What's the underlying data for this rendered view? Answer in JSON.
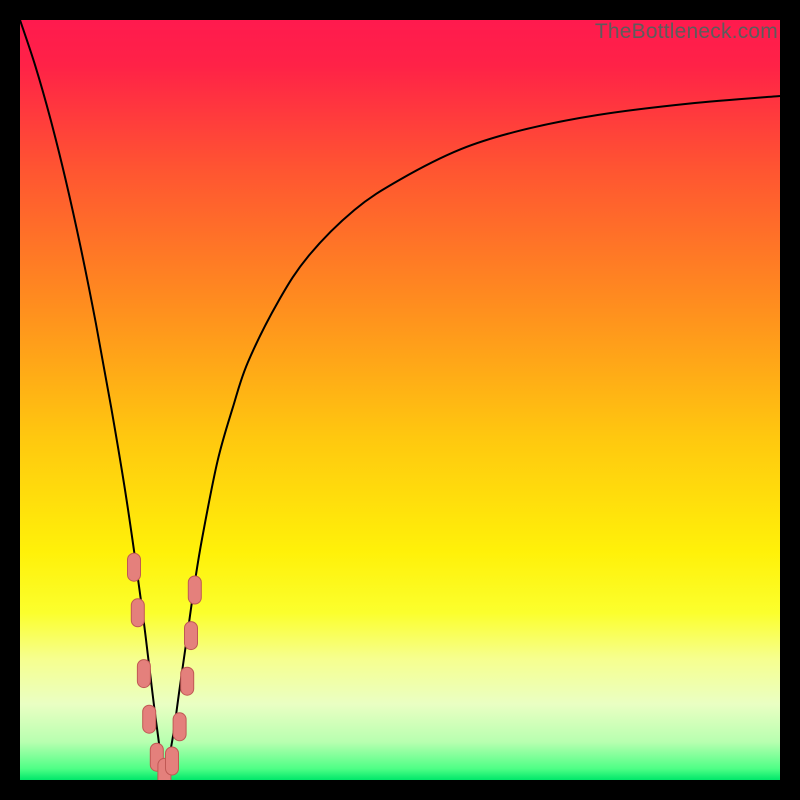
{
  "watermark": "TheBottleneck.com",
  "colors": {
    "frame": "#000000",
    "curve": "#000000",
    "marker_fill": "#e4807c",
    "marker_stroke": "#c05854",
    "gradient_stops": [
      {
        "offset": 0.0,
        "color": "#ff1a4e"
      },
      {
        "offset": 0.06,
        "color": "#ff2247"
      },
      {
        "offset": 0.2,
        "color": "#ff5631"
      },
      {
        "offset": 0.38,
        "color": "#ff8f1e"
      },
      {
        "offset": 0.55,
        "color": "#ffc80f"
      },
      {
        "offset": 0.7,
        "color": "#fff109"
      },
      {
        "offset": 0.78,
        "color": "#fbff2d"
      },
      {
        "offset": 0.84,
        "color": "#f6ff8e"
      },
      {
        "offset": 0.9,
        "color": "#eaffc3"
      },
      {
        "offset": 0.95,
        "color": "#b8ffb0"
      },
      {
        "offset": 0.985,
        "color": "#4fff86"
      },
      {
        "offset": 1.0,
        "color": "#00e76a"
      }
    ]
  },
  "chart_data": {
    "type": "line",
    "title": "",
    "xlabel": "",
    "ylabel": "",
    "xlim": [
      0,
      100
    ],
    "ylim": [
      0,
      100
    ],
    "grid": false,
    "note": "V-shaped bottleneck curve; x is normalized component scale (0–100), y is estimated bottleneck % (0=none, 100=severe). Minimum near x≈19.",
    "series": [
      {
        "name": "bottleneck_percent",
        "x": [
          0,
          2,
          4,
          6,
          8,
          10,
          12,
          14,
          16,
          17,
          18,
          19,
          20,
          21,
          22,
          23,
          24,
          26,
          28,
          30,
          34,
          38,
          44,
          50,
          58,
          66,
          76,
          88,
          100
        ],
        "values": [
          100,
          94,
          87,
          79,
          70,
          60,
          49,
          37,
          23,
          15,
          7,
          1,
          5,
          12,
          19,
          26,
          32,
          42,
          49,
          55,
          63,
          69,
          75,
          79,
          83,
          85.5,
          87.5,
          89,
          90
        ]
      }
    ],
    "markers": {
      "name": "highlighted_points",
      "note": "Pill-shaped markers clustered around the curve's trough.",
      "points": [
        {
          "x": 15.0,
          "y": 28
        },
        {
          "x": 15.5,
          "y": 22
        },
        {
          "x": 16.3,
          "y": 14
        },
        {
          "x": 17.0,
          "y": 8
        },
        {
          "x": 18.0,
          "y": 3
        },
        {
          "x": 19.0,
          "y": 1
        },
        {
          "x": 20.0,
          "y": 2.5
        },
        {
          "x": 21.0,
          "y": 7
        },
        {
          "x": 22.0,
          "y": 13
        },
        {
          "x": 22.5,
          "y": 19
        },
        {
          "x": 23.0,
          "y": 25
        }
      ]
    }
  }
}
